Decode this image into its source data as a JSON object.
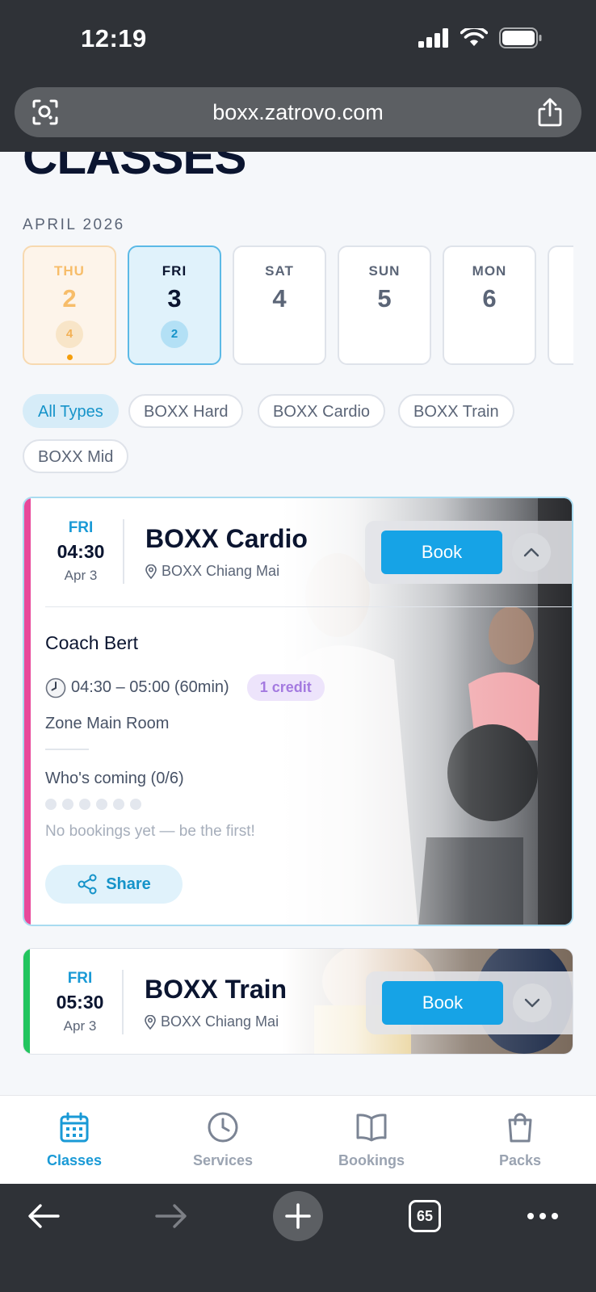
{
  "status": {
    "time": "12:19"
  },
  "browser": {
    "url": "boxx.zatrovo.com",
    "tabs_count": "65"
  },
  "page": {
    "title": "CLASSES",
    "month": "APRIL 2026"
  },
  "days": [
    {
      "name": "THU",
      "num": "2",
      "count": "4",
      "state": "past"
    },
    {
      "name": "FRI",
      "num": "3",
      "count": "2",
      "state": "selected"
    },
    {
      "name": "SAT",
      "num": "4"
    },
    {
      "name": "SUN",
      "num": "5"
    },
    {
      "name": "MON",
      "num": "6"
    }
  ],
  "filters": [
    "All Types",
    "BOXX Hard",
    "BOXX Cardio",
    "BOXX Train",
    "BOXX Mid"
  ],
  "classes": [
    {
      "weekday": "FRI",
      "time": "04:30",
      "date": "Apr 3",
      "name": "BOXX Cardio",
      "location": "BOXX Chiang Mai",
      "book_label": "Book",
      "stripe_color": "#e8489a",
      "coach": "Coach Bert",
      "time_range": "04:30 – 05:00 (60min)",
      "credit": "1 credit",
      "zone": "Zone Main Room",
      "whos_coming": "Who's coming (0/6)",
      "empty_text": "No bookings yet — be the first!",
      "share_label": "Share"
    },
    {
      "weekday": "FRI",
      "time": "05:30",
      "date": "Apr 3",
      "name": "BOXX Train",
      "location": "BOXX Chiang Mai",
      "book_label": "Book",
      "stripe_color": "#22c55e"
    }
  ],
  "nav": [
    {
      "label": "Classes",
      "icon": "calendar-icon",
      "active": true
    },
    {
      "label": "Services",
      "icon": "clock-icon"
    },
    {
      "label": "Bookings",
      "icon": "book-icon"
    },
    {
      "label": "Packs",
      "icon": "bag-icon"
    }
  ],
  "colors": {
    "accent": "#16a3e6",
    "cardio_stripe": "#e8489a",
    "train_stripe": "#22c55e",
    "credit": "#a47ae0"
  }
}
